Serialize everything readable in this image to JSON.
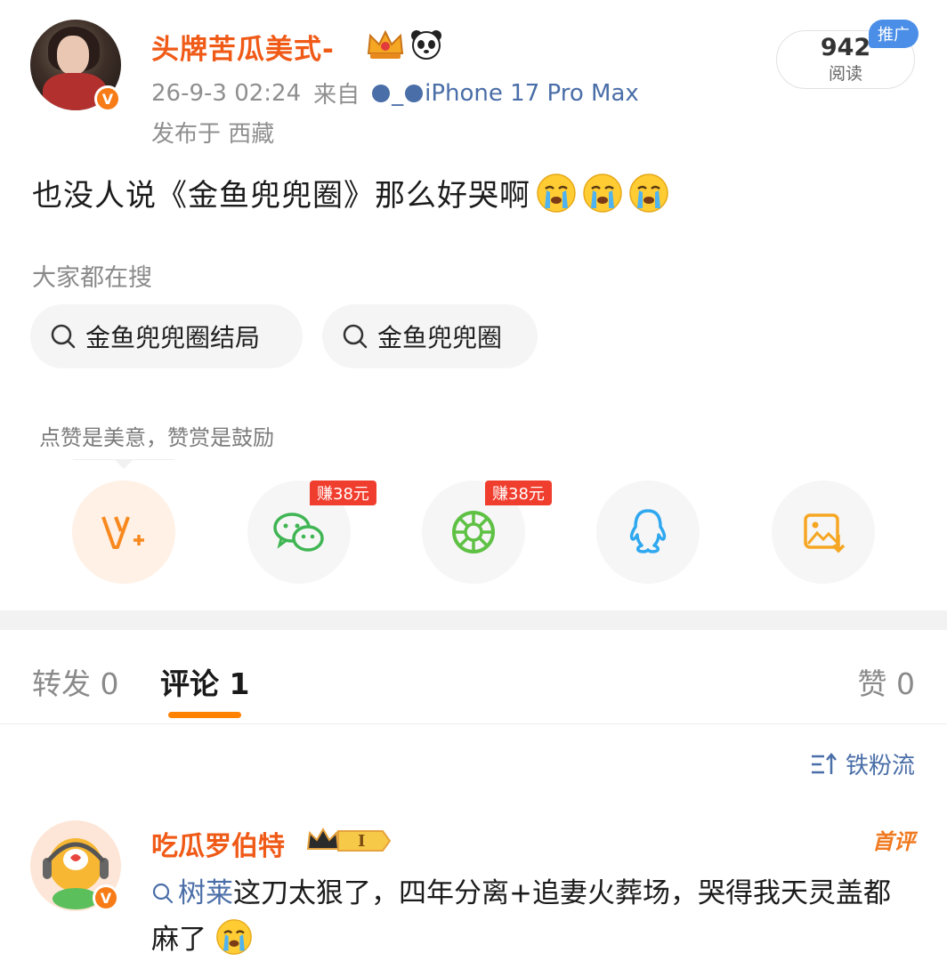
{
  "post": {
    "username": "头牌苦瓜美式-",
    "time": "26-9-3 02:24",
    "source_prefix": "来自",
    "source_device": "_",
    "device_name": "iPhone 17 Pro Max",
    "location": "发布于 西藏",
    "read_count": "942",
    "read_label": "阅读",
    "promo_label": "推广",
    "text": "也没人说《金鱼兜兜圈》那么好哭啊"
  },
  "search": {
    "title": "大家都在搜",
    "chips": [
      "金鱼兜兜圈结局",
      "金鱼兜兜圈"
    ]
  },
  "reward_tip": "点赞是美意，赞赏是鼓励",
  "share": {
    "earn_label_1": "赚38元",
    "earn_label_2": "赚38元",
    "items": [
      "reward-icon",
      "wechat-icon",
      "moments-icon",
      "qq-icon",
      "save-image-icon"
    ]
  },
  "tabs": {
    "repost": "转发 0",
    "comment": "评论 1",
    "like": "赞 0"
  },
  "sort_label": "铁粉流",
  "comment": {
    "username": "吃瓜罗伯特",
    "level": "I",
    "badge": "首评",
    "tag": "树莱",
    "text": "这刀太狠了，四年分离+追妻火葬场，哭得我天灵盖都麻了"
  },
  "colors": {
    "brand_orange": "#f05a17",
    "link_blue": "#4a6ea8",
    "tab_indicator": "#ff8200",
    "earn_red": "#f03e2e"
  }
}
